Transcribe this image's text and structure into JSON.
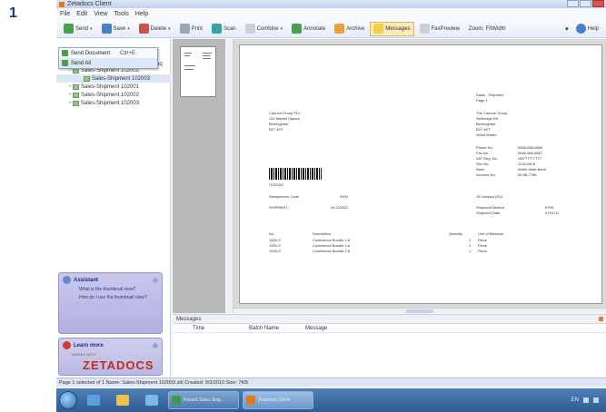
{
  "step_number": "1",
  "window": {
    "title": "Zetadocs Client",
    "controls": [
      "minimize",
      "maximize",
      "close"
    ]
  },
  "menu": [
    "File",
    "Edit",
    "View",
    "Tools",
    "Help"
  ],
  "toolbar": {
    "send": "Send",
    "save": "Save",
    "delete": "Delete",
    "print": "Print",
    "scan": "Scan",
    "combine": "Combine",
    "annotate": "Annotate",
    "archive": "Archive",
    "messages": "Messages",
    "fax_preview": "FaxPreview",
    "zoom": "Zoom: FitWidth",
    "help": "Help"
  },
  "send_menu": {
    "items": [
      {
        "label": "Send Document",
        "shortcut": "Ctrl+E"
      },
      {
        "label": "Send All",
        "shortcut": ""
      }
    ]
  },
  "tree": {
    "header_suffix": "pq",
    "items": [
      {
        "label": "Sales-Shipment 102002",
        "indent": 1,
        "expander": "−"
      },
      {
        "label": "Sales-Shipment 102003",
        "indent": 2,
        "expander": ""
      },
      {
        "label": "Sales-Shipment 102001",
        "indent": 1,
        "expander": "+"
      },
      {
        "label": "Sales-Shipment 102002",
        "indent": 1,
        "expander": "+"
      },
      {
        "label": "Sales-Shipment 102003",
        "indent": 1,
        "expander": "+"
      }
    ]
  },
  "assistant": {
    "title": "Assistant",
    "links": [
      "What is the thumbnail view?",
      "How do I use the thumbnail view?"
    ]
  },
  "learn": {
    "title": "Learn more",
    "subtitle": "WORKS WITH",
    "logo": "ZETADOCS"
  },
  "document": {
    "header": [
      "Sales - Shipment",
      "Page 1"
    ],
    "from_lines": [
      "Cannon Group PLC",
      "192 Market Square",
      "Birmingham",
      "B27 4KT"
    ],
    "ship_to": [
      "The Cannon Group",
      "Sellbridge Rd",
      "Birmingham",
      "B27 4KT",
      "Great Britain"
    ],
    "contact_labels": [
      "Phone No.",
      "Fax No.",
      "VAT Reg. No.",
      "Giro No.",
      "Bank",
      "Account No."
    ],
    "contact_values": [
      "0666-666-6666",
      "0666-666-6667",
      "GB777777777",
      "1234-5678",
      "World Wide Bank",
      "99-88-7766"
    ],
    "barcode_text": "*102002*",
    "ref_label": "Salesperson Code",
    "ref_value": "4000",
    "ref_row2": [
      "SHIPMENT",
      "Nr 102002"
    ],
    "date_label": "15 January 2011",
    "lines_header": [
      "No.",
      "Description",
      "Quantity",
      "Unit of Measure"
    ],
    "lines": [
      [
        "1900-S",
        "Conference Bundle 1-8",
        "2",
        "Piece"
      ],
      [
        "1920-S",
        "Conference Bundle 1-6",
        "2",
        "Piece"
      ],
      [
        "1928-S",
        "Conference Bundle 2-8",
        "1",
        "Piece"
      ]
    ],
    "shipment_method": [
      "Shipment Method",
      "Shipment Date"
    ],
    "shipment_values": [
      "EXW",
      "07/01/11"
    ]
  },
  "messages": {
    "title": "Messages",
    "columns": [
      "Time",
      "Batch Name",
      "Message"
    ]
  },
  "statusbar": "Page 1 selected of 1  Name: Sales-Shipment 102003.zdi  Created: 9/3/2010  Size: 7KB",
  "taskbar": {
    "tasks": [
      {
        "label": "Posted Sales Ship...",
        "active": false
      },
      {
        "label": "Zetadocs Client",
        "active": true
      }
    ],
    "tray": "EN"
  }
}
